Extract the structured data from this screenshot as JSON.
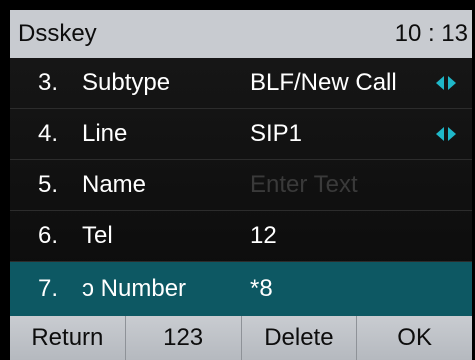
{
  "header": {
    "title": "Dsskey",
    "time": "10 : 13"
  },
  "rows": [
    {
      "num": "3.",
      "label": "Subtype",
      "value": "BLF/New Call",
      "has_arrows": true
    },
    {
      "num": "4.",
      "label": "Line",
      "value": "SIP1",
      "has_arrows": true
    },
    {
      "num": "5.",
      "label": "Name",
      "placeholder": "Enter Text"
    },
    {
      "num": "6.",
      "label": "Tel",
      "value": "12"
    },
    {
      "num": "7.",
      "label": "ɔ Number",
      "value": "*8",
      "selected": true
    }
  ],
  "softkeys": {
    "return": "Return",
    "ime": "123",
    "delete": "Delete",
    "ok": "OK"
  },
  "colors": {
    "accent": "#1fb8c9",
    "selected_row": "#0d5863",
    "bar": "#c8cbd0"
  }
}
